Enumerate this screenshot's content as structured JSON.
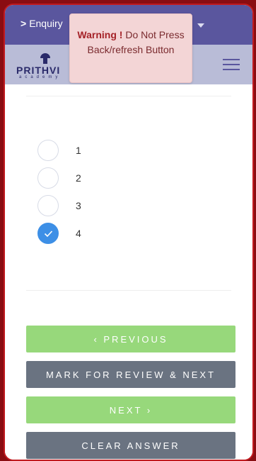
{
  "header": {
    "enquiry_label": "Enquiry",
    "enquiry_chevron": ">"
  },
  "logo": {
    "name": "PRITHVI",
    "subtitle": "academy"
  },
  "toast": {
    "warning_label": "Warning !",
    "message": "Do Not Press Back/refresh Button"
  },
  "question": {
    "options": [
      {
        "label": "1",
        "selected": false
      },
      {
        "label": "2",
        "selected": false
      },
      {
        "label": "3",
        "selected": false
      },
      {
        "label": "4",
        "selected": true
      }
    ]
  },
  "buttons": {
    "previous": "‹  PREVIOUS",
    "mark_review": "MARK FOR REVIEW & NEXT",
    "next": "NEXT  ›",
    "clear": "CLEAR ANSWER"
  },
  "colors": {
    "header": "#5a569e",
    "navbar": "#b9bcd7",
    "green_button": "#97d87b",
    "gray_button": "#6a7381",
    "selected_radio": "#3d8fe6",
    "frame": "#8a0d12"
  }
}
